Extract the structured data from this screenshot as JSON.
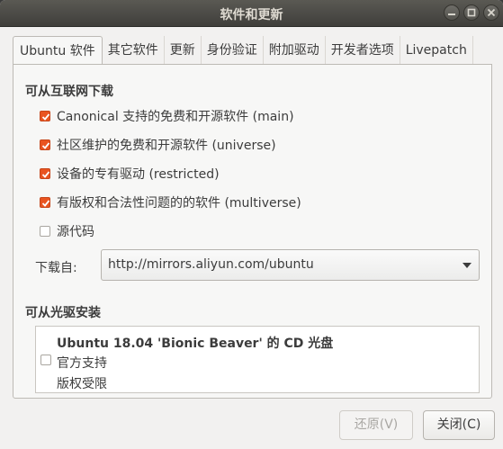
{
  "window": {
    "title": "软件和更新"
  },
  "tabs": [
    {
      "label": "Ubuntu 软件",
      "active": true
    },
    {
      "label": "其它软件"
    },
    {
      "label": "更新"
    },
    {
      "label": "身份验证"
    },
    {
      "label": "附加驱动"
    },
    {
      "label": "开发者选项"
    },
    {
      "label": "Livepatch"
    }
  ],
  "internet": {
    "heading": "可从互联网下载",
    "sources": [
      {
        "label": "Canonical 支持的免费和开源软件 (main)",
        "checked": true
      },
      {
        "label": "社区维护的免费和开源软件 (universe)",
        "checked": true
      },
      {
        "label": "设备的专有驱动 (restricted)",
        "checked": true
      },
      {
        "label": "有版权和合法性问题的的软件 (multiverse)",
        "checked": true
      },
      {
        "label": "源代码",
        "checked": false
      }
    ],
    "download_from_label": "下载自:",
    "download_from_value": "http://mirrors.aliyun.com/ubuntu"
  },
  "cdrom": {
    "heading": "可从光驱安装",
    "name": "Ubuntu 18.04 'Bionic Beaver' 的 CD 光盘",
    "line1": "官方支持",
    "line2": "版权受限",
    "checked": false
  },
  "buttons": {
    "revert": "还原(V)",
    "close": "关闭(C)"
  },
  "colors": {
    "accent": "#e95420",
    "titlebar": "#4a4945",
    "background": "#f2f1f0"
  }
}
